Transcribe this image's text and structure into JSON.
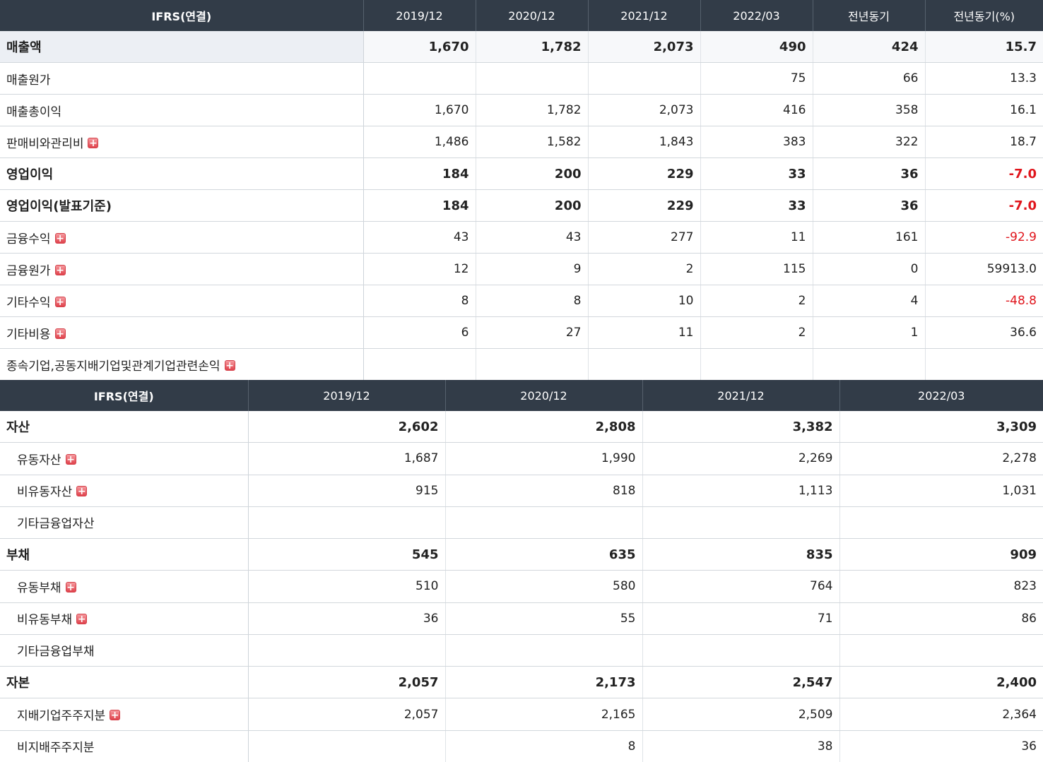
{
  "income": {
    "headers": [
      "IFRS(연결)",
      "2019/12",
      "2020/12",
      "2021/12",
      "2022/03",
      "전년동기",
      "전년동기(%)"
    ],
    "rows": [
      {
        "label": "매출액",
        "values": [
          "1,670",
          "1,782",
          "2,073",
          "490",
          "424",
          "15.7"
        ]
      },
      {
        "label": "매출원가",
        "values": [
          "",
          "",
          "",
          "75",
          "66",
          "13.3"
        ]
      },
      {
        "label": "매출총이익",
        "values": [
          "1,670",
          "1,782",
          "2,073",
          "416",
          "358",
          "16.1"
        ]
      },
      {
        "label": "판매비와관리비",
        "values": [
          "1,486",
          "1,582",
          "1,843",
          "383",
          "322",
          "18.7"
        ]
      },
      {
        "label": "영업이익",
        "values": [
          "184",
          "200",
          "229",
          "33",
          "36",
          "-7.0"
        ]
      },
      {
        "label": "영업이익(발표기준)",
        "values": [
          "184",
          "200",
          "229",
          "33",
          "36",
          "-7.0"
        ]
      },
      {
        "label": "금융수익",
        "values": [
          "43",
          "43",
          "277",
          "11",
          "161",
          "-92.9"
        ]
      },
      {
        "label": "금융원가",
        "values": [
          "12",
          "9",
          "2",
          "115",
          "0",
          "59913.0"
        ]
      },
      {
        "label": "기타수익",
        "values": [
          "8",
          "8",
          "10",
          "2",
          "4",
          "-48.8"
        ]
      },
      {
        "label": "기타비용",
        "values": [
          "6",
          "27",
          "11",
          "2",
          "1",
          "36.6"
        ]
      },
      {
        "label": "종속기업,공동지배기업및관계기업관련손익",
        "values": [
          "",
          "",
          "",
          "",
          "",
          ""
        ]
      }
    ]
  },
  "balance": {
    "headers": [
      "IFRS(연결)",
      "2019/12",
      "2020/12",
      "2021/12",
      "2022/03"
    ],
    "rows": [
      {
        "label": "자산",
        "values": [
          "2,602",
          "2,808",
          "3,382",
          "3,309"
        ]
      },
      {
        "label": "유동자산",
        "values": [
          "1,687",
          "1,990",
          "2,269",
          "2,278"
        ]
      },
      {
        "label": "비유동자산",
        "values": [
          "915",
          "818",
          "1,113",
          "1,031"
        ]
      },
      {
        "label": "기타금융업자산",
        "values": [
          "",
          "",
          "",
          ""
        ]
      },
      {
        "label": "부채",
        "values": [
          "545",
          "635",
          "835",
          "909"
        ]
      },
      {
        "label": "유동부채",
        "values": [
          "510",
          "580",
          "764",
          "823"
        ]
      },
      {
        "label": "비유동부채",
        "values": [
          "36",
          "55",
          "71",
          "86"
        ]
      },
      {
        "label": "기타금융업부채",
        "values": [
          "",
          "",
          "",
          ""
        ]
      },
      {
        "label": "자본",
        "values": [
          "2,057",
          "2,173",
          "2,547",
          "2,400"
        ]
      },
      {
        "label": "지배기업주주지분",
        "values": [
          "2,057",
          "2,165",
          "2,509",
          "2,364"
        ]
      },
      {
        "label": "비지배주주지분",
        "values": [
          "",
          "8",
          "38",
          "36"
        ]
      }
    ]
  },
  "colors": {
    "header_bg": "#323c48",
    "negative": "#e0151c",
    "expand_icon": "#e0424c"
  },
  "icons": {
    "expand": "plus-square-icon"
  }
}
